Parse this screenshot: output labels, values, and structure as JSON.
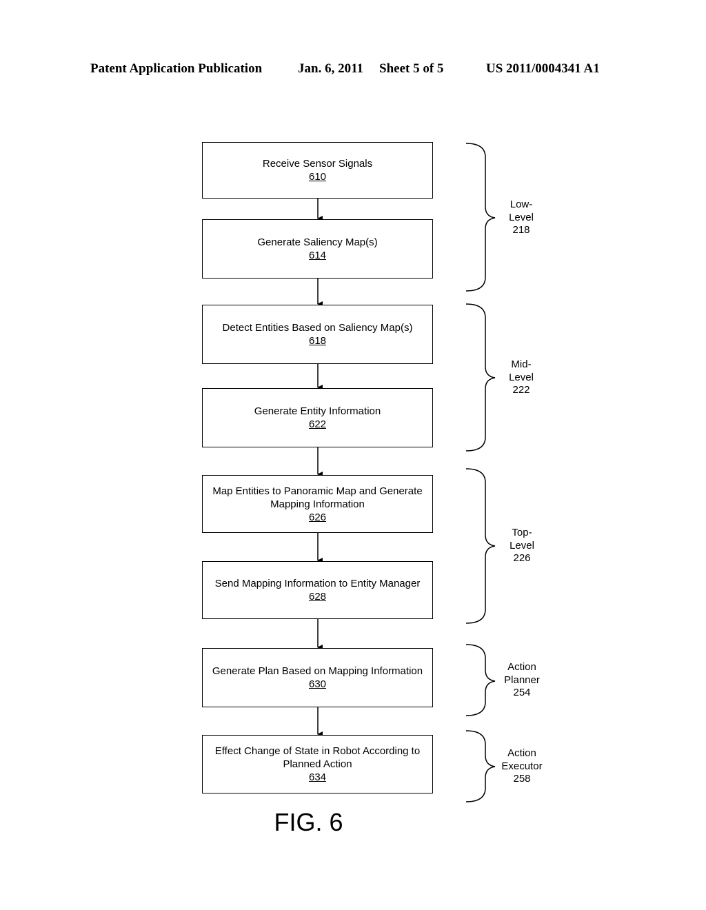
{
  "header": {
    "publication": "Patent Application Publication",
    "date": "Jan. 6, 2011",
    "sheet": "Sheet 5 of 5",
    "number": "US 2011/0004341 A1"
  },
  "steps": [
    {
      "label": "Receive Sensor Signals",
      "num": "610"
    },
    {
      "label": "Generate Saliency Map(s)",
      "num": "614"
    },
    {
      "label": "Detect Entities Based on Saliency Map(s)",
      "num": "618"
    },
    {
      "label": "Generate Entity Information",
      "num": "622"
    },
    {
      "label": "Map Entities to Panoramic Map and Generate Mapping Information",
      "num": "626"
    },
    {
      "label": "Send Mapping Information to Entity Manager",
      "num": "628"
    },
    {
      "label": "Generate Plan Based on Mapping Information",
      "num": "630"
    },
    {
      "label": "Effect Change of State in Robot According to Planned Action",
      "num": "634"
    }
  ],
  "groups": [
    {
      "line1": "Low-",
      "line2": "Level",
      "num": "218"
    },
    {
      "line1": "Mid-",
      "line2": "Level",
      "num": "222"
    },
    {
      "line1": "Top-",
      "line2": "Level",
      "num": "226"
    },
    {
      "line1": "Action",
      "line2": "Planner",
      "num": "254"
    },
    {
      "line1": "Action",
      "line2": "Executor",
      "num": "258"
    }
  ],
  "figure_label": "FIG. 6"
}
